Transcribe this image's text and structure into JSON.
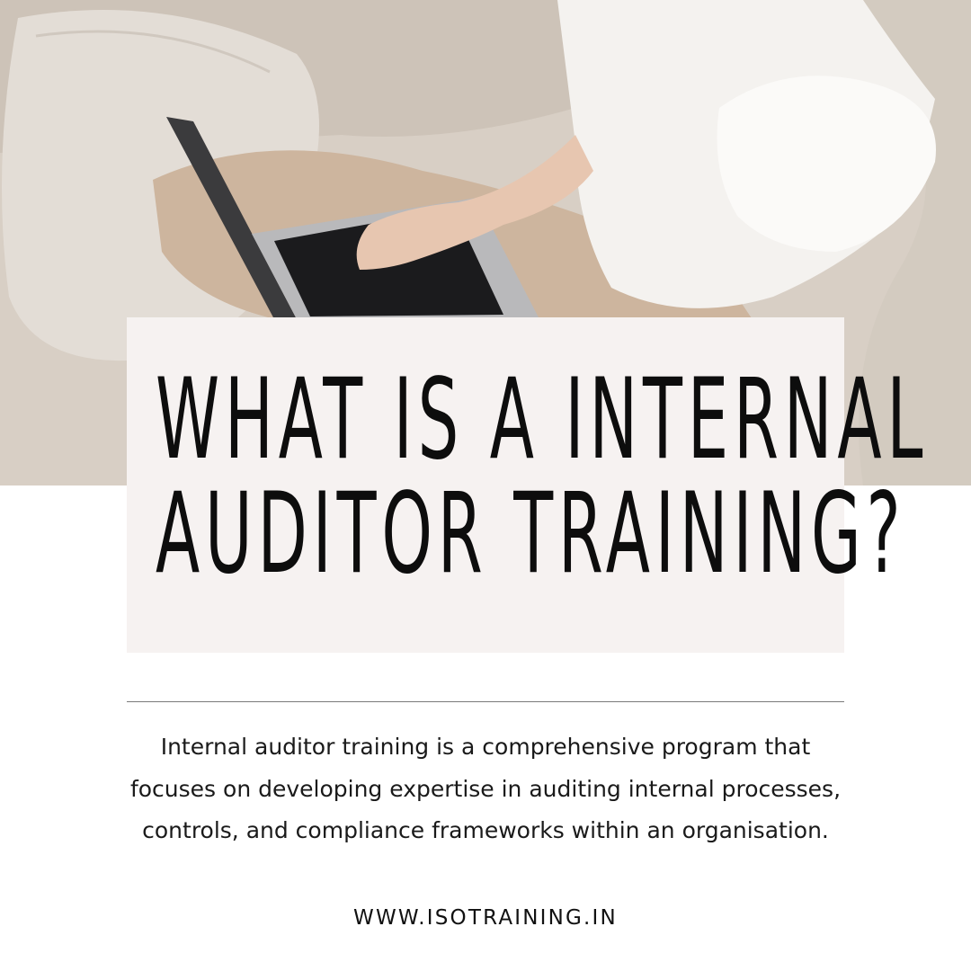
{
  "hero": {
    "title_line_1": "WHAT IS A INTERNAL",
    "title_line_2": "AUDITOR TRAINING?"
  },
  "body": {
    "description": "Internal auditor training is a comprehensive program that focuses on developing expertise in auditing internal processes, controls, and compliance frameworks within an organisation."
  },
  "footer": {
    "website": "WWW.ISOTRAINING.IN"
  },
  "colors": {
    "title_box_bg": "#f6f2f1",
    "text": "#111111",
    "divider": "#7a7a7a"
  }
}
